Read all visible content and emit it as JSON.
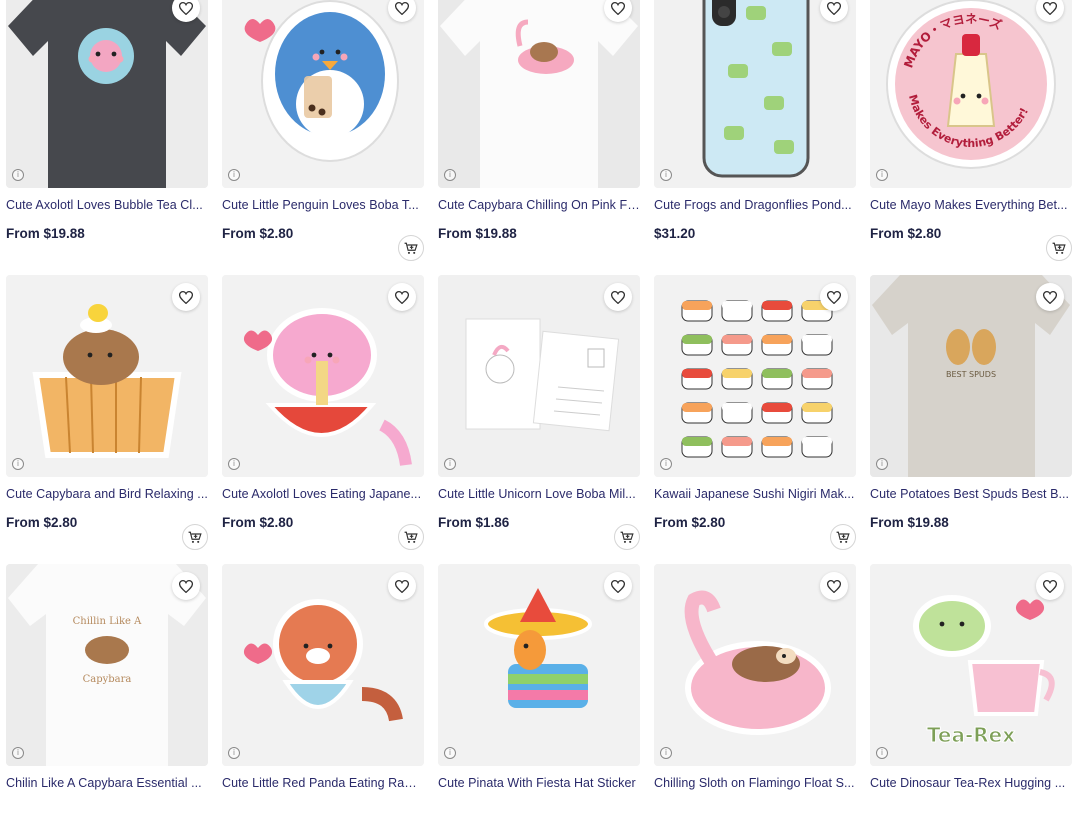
{
  "products": [
    {
      "title": "Cute Axolotl Loves Bubble Tea Cl...",
      "price": "From $19.88",
      "cart": false,
      "art": "tshirt-dark"
    },
    {
      "title": "Cute Little Penguin Loves Boba T...",
      "price": "From $2.80",
      "cart": true,
      "art": "penguin"
    },
    {
      "title": "Cute Capybara Chilling On Pink Fl...",
      "price": "From $19.88",
      "cart": false,
      "art": "tshirt-white"
    },
    {
      "title": "Cute Frogs and Dragonflies Pond...",
      "price": "$31.20",
      "cart": false,
      "art": "phone"
    },
    {
      "title": "Cute Mayo Makes Everything Bet...",
      "price": "From $2.80",
      "cart": true,
      "art": "mayo",
      "art_text_top": "MAYO・マヨネーズ",
      "art_text_bottom": "Makes Everything Better!"
    },
    {
      "title": "Cute Capybara and Bird Relaxing ...",
      "price": "From $2.80",
      "cart": true,
      "art": "capybara-tub"
    },
    {
      "title": "Cute Axolotl Loves Eating Japane...",
      "price": "From $2.80",
      "cart": true,
      "art": "axolotl-ramen"
    },
    {
      "title": "Cute Little Unicorn Love Boba Mil...",
      "price": "From $1.86",
      "cart": true,
      "art": "postcard"
    },
    {
      "title": "Kawaii Japanese Sushi Nigiri Mak...",
      "price": "From $2.80",
      "cart": true,
      "art": "sushi"
    },
    {
      "title": "Cute Potatoes Best Spuds Best B...",
      "price": "From $19.88",
      "cart": false,
      "art": "tshirt-grey",
      "art_text": "BEST SPUDS"
    },
    {
      "title": "Chilin Like A Capybara Essential ...",
      "price": "",
      "cart": false,
      "art": "tshirt-capybara",
      "art_text_top": "Chillin Like A",
      "art_text_bottom": "Capybara"
    },
    {
      "title": "Cute Little Red Panda Eating Ram...",
      "price": "",
      "cart": false,
      "art": "redpanda"
    },
    {
      "title": "Cute Pinata With Fiesta Hat Sticker",
      "price": "",
      "cart": false,
      "art": "pinata"
    },
    {
      "title": "Chilling Sloth on Flamingo Float S...",
      "price": "",
      "cart": false,
      "art": "sloth"
    },
    {
      "title": "Cute Dinosaur Tea-Rex Hugging ...",
      "price": "",
      "cart": false,
      "art": "dino",
      "art_text": "Tea-Rex"
    }
  ]
}
